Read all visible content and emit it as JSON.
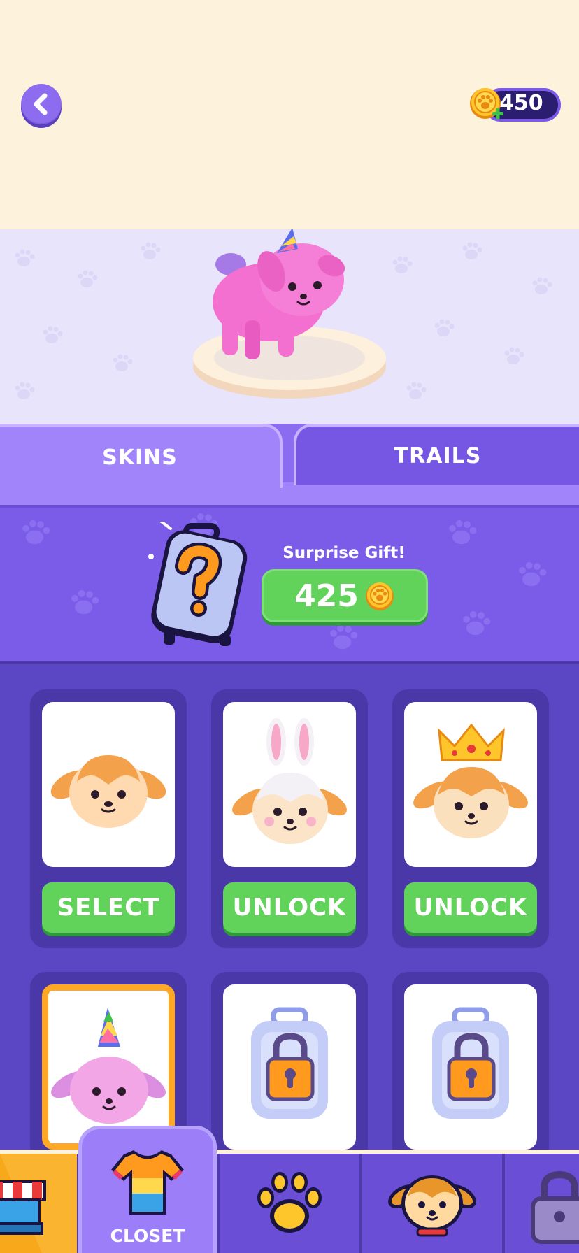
{
  "header": {
    "back_icon": "chevron-left-icon",
    "currency_icon": "paw-coin-plus-icon",
    "currency_amount": "450"
  },
  "tabs": [
    {
      "label": "SKINS",
      "active": true
    },
    {
      "label": "TRAILS",
      "active": false
    }
  ],
  "gift": {
    "title": "Surprise Gift!",
    "price": "425",
    "price_icon": "paw-coin-icon",
    "crate_icon": "mystery-crate-icon"
  },
  "skins": [
    {
      "name": "classic-pup",
      "button": "SELECT",
      "state": "owned"
    },
    {
      "name": "bunny-pup",
      "button": "UNLOCK",
      "state": "locked"
    },
    {
      "name": "king-pup",
      "button": "UNLOCK",
      "state": "locked"
    },
    {
      "name": "unicorn-pup",
      "button": "",
      "state": "selected"
    },
    {
      "name": "locked-crate",
      "button": "",
      "state": "hidden"
    },
    {
      "name": "locked-crate",
      "button": "",
      "state": "hidden"
    }
  ],
  "nav": {
    "closet_label": "CLOSET",
    "items": [
      "shop-icon",
      "shirt-icon",
      "paw-icon",
      "dog-face-icon",
      "lock-icon"
    ]
  },
  "colors": {
    "cream": "#fdf3dc",
    "purple_dark": "#5b47c4",
    "purple_mid": "#7a5ce8",
    "purple_light": "#a184fa",
    "green": "#62d35a",
    "orange": "#ffa826",
    "pink": "#f36fd0"
  }
}
